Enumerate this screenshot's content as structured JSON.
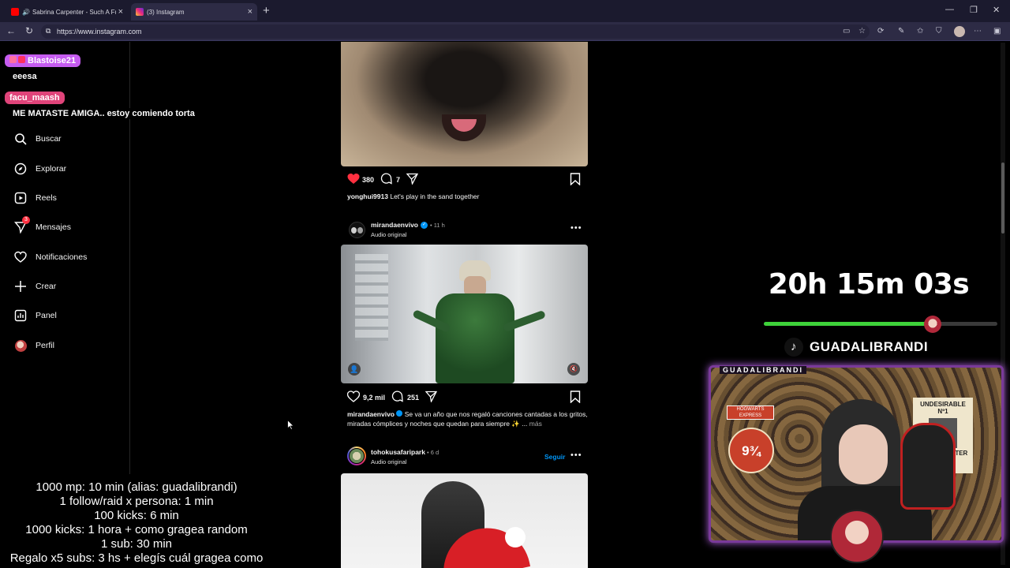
{
  "browser": {
    "tabs": [
      {
        "title": "Sabrina Carpenter - Such A Fu",
        "active": false
      },
      {
        "title": "(3) Instagram",
        "active": true
      }
    ],
    "url": "https://www.instagram.com"
  },
  "sidebar": {
    "items": [
      {
        "label": "Buscar",
        "icon": "search-icon"
      },
      {
        "label": "Explorar",
        "icon": "compass-icon"
      },
      {
        "label": "Reels",
        "icon": "reels-icon"
      },
      {
        "label": "Mensajes",
        "icon": "messenger-icon",
        "badge": "3"
      },
      {
        "label": "Notificaciones",
        "icon": "heart-icon"
      },
      {
        "label": "Crear",
        "icon": "plus-icon"
      },
      {
        "label": "Panel",
        "icon": "chart-icon"
      },
      {
        "label": "Perfil",
        "icon": "avatar-icon"
      }
    ]
  },
  "chat": {
    "messages": [
      {
        "user": "Blastoise21",
        "text": "eeesa",
        "color": "#c65cf0"
      },
      {
        "user": "facu_maash",
        "text": "ME MATASTE AMIGA.. estoy comiendo torta",
        "color": "#e0447a"
      }
    ]
  },
  "feed": {
    "post1": {
      "likes": "380",
      "comments": "7",
      "liked": true,
      "caption_user": "yonghui9913",
      "caption_text": "Let's play in the sand together"
    },
    "post2": {
      "user": "mirandaenvivo",
      "verified": true,
      "time": "11 h",
      "audio": "Audio original",
      "likes": "9,2 mil",
      "comments": "251",
      "caption_user": "mirandaenvivo",
      "caption_text": "Se va un año que nos regaló canciones cantadas a los gritos, miradas cómplices y noches que quedan para siempre",
      "more": "más"
    },
    "post3": {
      "user": "tohokusafaripark",
      "time": "6 d",
      "audio": "Audio original",
      "follow": "Seguir"
    }
  },
  "stream": {
    "timer": "20h 15m 03s",
    "progress": 0.7,
    "tiktok_handle": "GUADALIBRANDI",
    "cam_label": "GUADALIBRANDI",
    "rules": [
      "1000 mp: 10 min (alias: guadalibrandi)",
      "1 follow/raid x persona: 1 min",
      "100 kicks: 6 min",
      "1000 kicks: 1 hora + como gragea random",
      "1 sub: 30 min",
      "Regalo x5 subs: 3 hs + elegís cuál gragea como"
    ]
  }
}
